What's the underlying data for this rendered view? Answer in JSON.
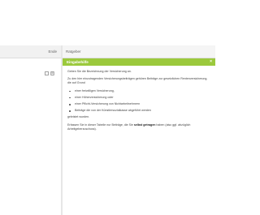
{
  "left_panel": {
    "top_label": "Ende"
  },
  "right_panel": {
    "header": "Ratgeber",
    "help_title": "Eingabehilfe",
    "help_close": "×",
    "p1": "Geben Sie die Bezeichnung der Versicherung an.",
    "p2": "Zu den hier einzutragenden Versicherungsbeiträgen gehören Beiträge zur gesetzlichen Rentenversicherung, die auf Grund",
    "bullets": [
      "einer freiwilligen Versicherung,",
      "einer Höherversicherung oder",
      "einer Pflicht-Versicherung von Nichtarbeitnehmern",
      "Beiträge die von der Künstlersozialkasse abgeführt werden"
    ],
    "p3": "geleistet wurden.",
    "p4_pre": "Erfassen Sie in dieser Tabelle nur Beiträge, die Sie ",
    "p4_bold": "selbst getragen",
    "p4_post": " haben (also ggf. abzüglich Arbeitgeberzuschuss)."
  },
  "icons": [
    "checkbox-icon",
    "document-icon"
  ]
}
